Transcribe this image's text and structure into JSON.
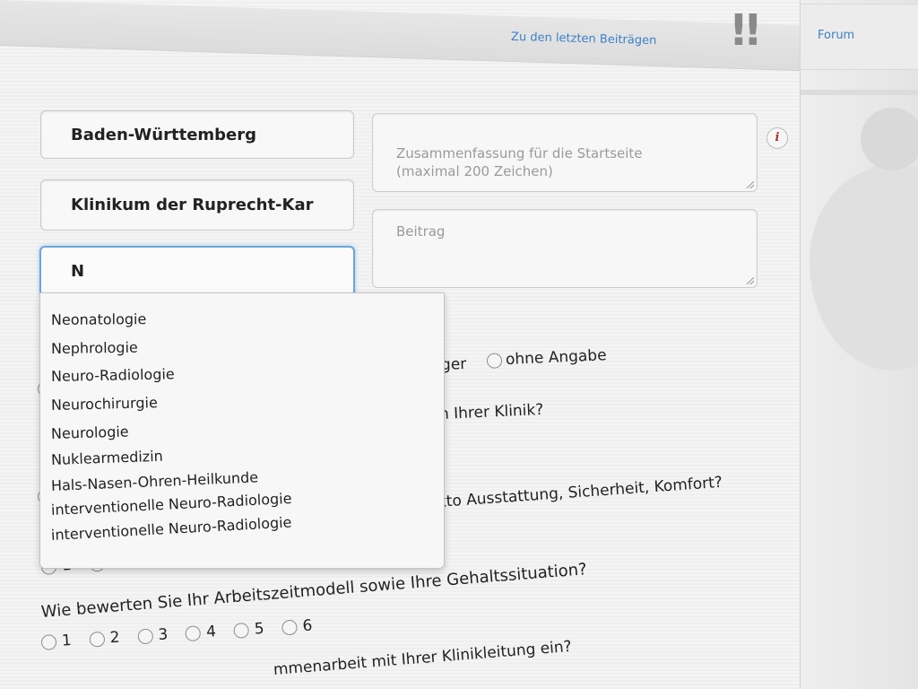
{
  "header": {
    "latest_posts_link": "Zu den letzten Beiträgen",
    "alert_icon": "double-exclamation"
  },
  "sidebar": {
    "forum_link": "Forum"
  },
  "form": {
    "state_value": "Baden-Württemberg",
    "clinic_value": "Klinikum der Ruprecht-Kar",
    "specialty_value": "N",
    "summary_placeholder": "Zusammenfassung für die Startseite\n(maximal 200 Zeichen)",
    "post_placeholder": "Beitrag",
    "info_icon": "i"
  },
  "dropdown": {
    "options": [
      "Neonatologie",
      "Nephrologie",
      "Neuro-Radiologie",
      "Neurochirurgie",
      "Neurologie",
      "Nuklearmedizin",
      "Hals-Nasen-Ohren-Heilkunde",
      "interventionelle Neuro-Radiologie",
      "interventionelle Neuro-Radiologie"
    ]
  },
  "questions": {
    "gender_fragment": "ger",
    "gender_option_none": "ohne Angabe",
    "q1_fragment": "n Ihrer Klinik?",
    "q2_fragment": "kto Ausstattung, Sicherheit, Komfort?",
    "q3": "Wie bewerten Sie Ihr Arbeitszeitmodell sowie Ihre Gehaltssituation?",
    "q4_fragment": "mmenarbeit mit Ihrer Klinikleitung ein?",
    "scale": [
      "1",
      "2",
      "3",
      "4",
      "5",
      "6"
    ]
  }
}
